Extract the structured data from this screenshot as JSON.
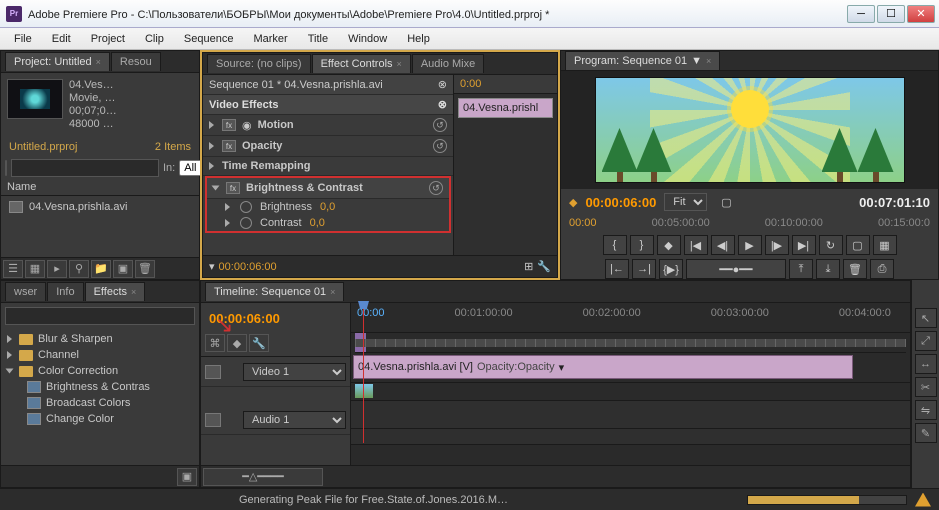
{
  "titlebar": {
    "app_name": "Adobe Premiere Pro",
    "title_sep": " - ",
    "document_path": "C:\\Пользователи\\БОБРЫ\\Мои документы\\Adobe\\Premiere Pro\\4.0\\Untitled.prproj *"
  },
  "menu": {
    "file": "File",
    "edit": "Edit",
    "project": "Project",
    "clip": "Clip",
    "sequence": "Sequence",
    "marker": "Marker",
    "title": "Title",
    "window": "Window",
    "help": "Help"
  },
  "project_panel": {
    "tab_project": "Project: Untitled",
    "tab_resource": "Resou",
    "clip_name": "04.Ves…",
    "clip_type": "Movie, …",
    "clip_dur": "00;07;0…",
    "clip_rate": "48000 …",
    "proj_file": "Untitled.prproj",
    "item_count": "2 Items",
    "in_label": "In:",
    "in_value": "All",
    "col_name": "Name",
    "item1": "04.Vesna.prishla.avi"
  },
  "effect_controls": {
    "tab_source": "Source: (no clips)",
    "tab_ec": "Effect Controls",
    "tab_audio": "Audio Mixe",
    "seq_title": "Sequence 01 * 04.Vesna.prishla.avi",
    "section_video": "Video Effects",
    "fx_motion": "Motion",
    "fx_opacity": "Opacity",
    "fx_time": "Time Remapping",
    "fx_bc": "Brightness & Contrast",
    "prop_brightness": "Brightness",
    "prop_contrast": "Contrast",
    "val_zero": "0,0",
    "time_head": "0:00",
    "clip_label": "04.Vesna.prishl",
    "foot_time": "00:00:06:00"
  },
  "program": {
    "tab": "Program: Sequence 01",
    "cur_time": "00:00:06:00",
    "fit": "Fit",
    "total_time": "00:07:01:10",
    "r1": "00:00",
    "r2": "00:05:00:00",
    "r3": "00:10:00:00",
    "r4": "00:15:00:0"
  },
  "effects_browser": {
    "tab_browser": "wser",
    "tab_info": "Info",
    "tab_effects": "Effects",
    "blur": "Blur & Sharpen",
    "channel": "Channel",
    "cc": "Color Correction",
    "bc": "Brightness & Contras",
    "broadcast": "Broadcast Colors",
    "change": "Change Color"
  },
  "timeline": {
    "tab": "Timeline: Sequence 01",
    "cur_time": "00:00:06:00",
    "r1": "00:00",
    "r2": "00:01:00:00",
    "r3": "00:02:00:00",
    "r4": "00:03:00:00",
    "r5": "00:04:00:0",
    "video1": "Video 1",
    "audio1": "Audio 1",
    "clip_label": "04.Vesna.prishla.avi [V]",
    "clip_mode": "Opacity:Opacity"
  },
  "status": {
    "message": "Generating Peak File for Free.State.of.Jones.2016.M…"
  }
}
